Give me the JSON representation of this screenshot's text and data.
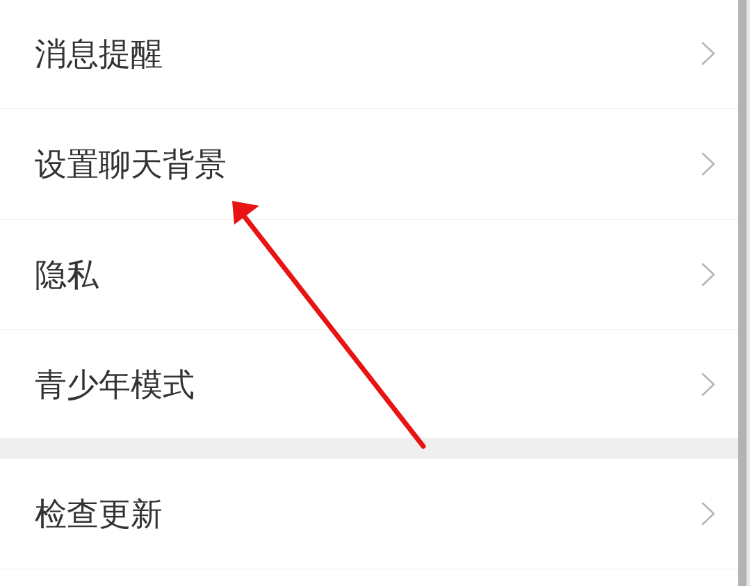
{
  "sections": [
    {
      "items": [
        {
          "label": "消息提醒"
        },
        {
          "label": "设置聊天背景"
        },
        {
          "label": "隐私"
        },
        {
          "label": "青少年模式"
        }
      ]
    },
    {
      "items": [
        {
          "label": "检查更新"
        }
      ]
    }
  ]
}
